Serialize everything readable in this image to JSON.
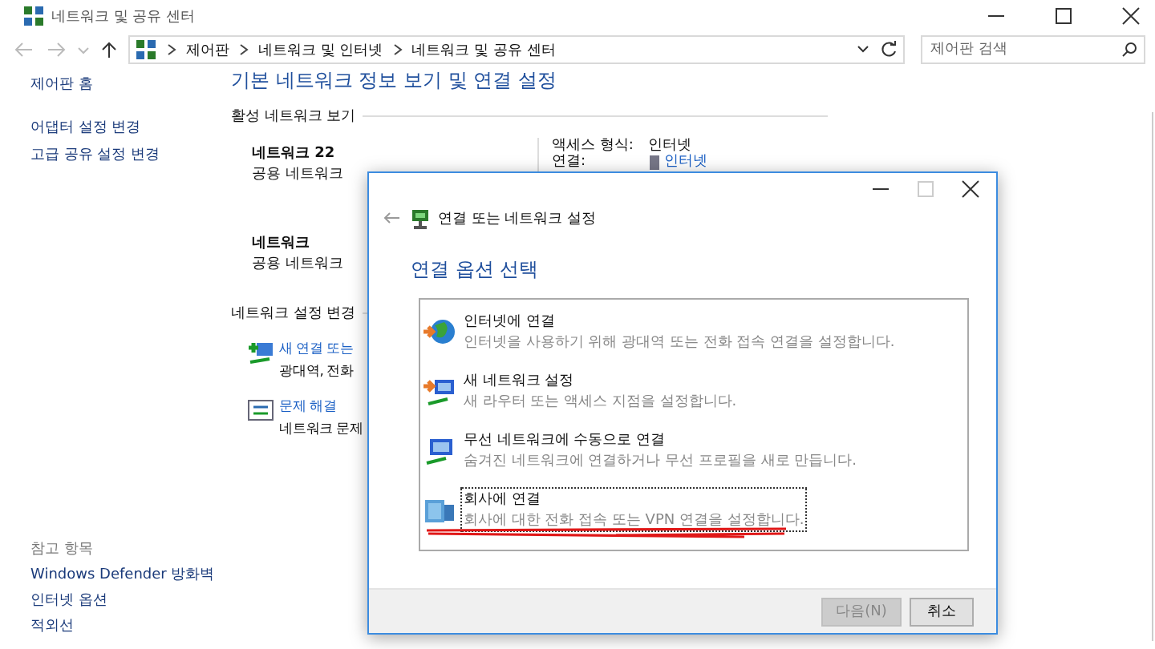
{
  "window": {
    "title": "네트워크 및 공유 센터"
  },
  "address_bar": {
    "breadcrumbs": [
      "제어판",
      "네트워크 및 인터넷",
      "네트워크 및 공유 센터"
    ]
  },
  "search": {
    "placeholder": "제어판 검색"
  },
  "sidebar": {
    "items": [
      {
        "label": "제어판 홈"
      },
      {
        "label": "어댑터 설정 변경"
      },
      {
        "label": "고급 공유 설정 변경"
      }
    ],
    "see_also": {
      "heading": "참고 항목",
      "items": [
        "Windows Defender 방화벽",
        "인터넷 옵션",
        "적외선"
      ]
    }
  },
  "main": {
    "heading": "기본 네트워크 정보 보기 및 연결 설정",
    "active_section": {
      "title": "활성 네트워크 보기",
      "networks": [
        {
          "name": "네트워크 22",
          "type": "공용 네트워크"
        },
        {
          "name": "네트워크",
          "type": "공용 네트워크"
        }
      ],
      "access_label": "액세스 형식:",
      "access_value": "인터넷",
      "connection_label": "연결:",
      "connection_value": "인터넷"
    },
    "change_section": {
      "title": "네트워크 설정 변경",
      "tasks": [
        {
          "kind": "new-connection",
          "title": "새 연결 또는",
          "description": "광대역, 전화"
        },
        {
          "kind": "troubleshoot",
          "title": "문제 해결",
          "description": "네트워크 문제"
        }
      ]
    }
  },
  "dialog": {
    "title": "연결 또는 네트워크 설정",
    "heading": "연결 옵션 선택",
    "options": [
      {
        "kind": "internet",
        "title": "인터넷에 연결",
        "description": "인터넷을 사용하기 위해 광대역 또는 전화 접속 연결을 설정합니다.",
        "selected": false
      },
      {
        "kind": "router",
        "title": "새 네트워크 설정",
        "description": "새 라우터 또는 액세스 지점을 설정합니다.",
        "selected": false
      },
      {
        "kind": "wireless",
        "title": "무선 네트워크에 수동으로 연결",
        "description": "숨겨진 네트워크에 연결하거나 무선 프로필을 새로 만듭니다.",
        "selected": false
      },
      {
        "kind": "workplace",
        "title": "회사에 연결",
        "description": "회사에 대한 전화 접속 또는 VPN 연결을 설정합니다.",
        "selected": true
      }
    ],
    "buttons": [
      {
        "label": "다음(N)",
        "disabled": true
      },
      {
        "label": "취소",
        "disabled": false
      }
    ]
  }
}
